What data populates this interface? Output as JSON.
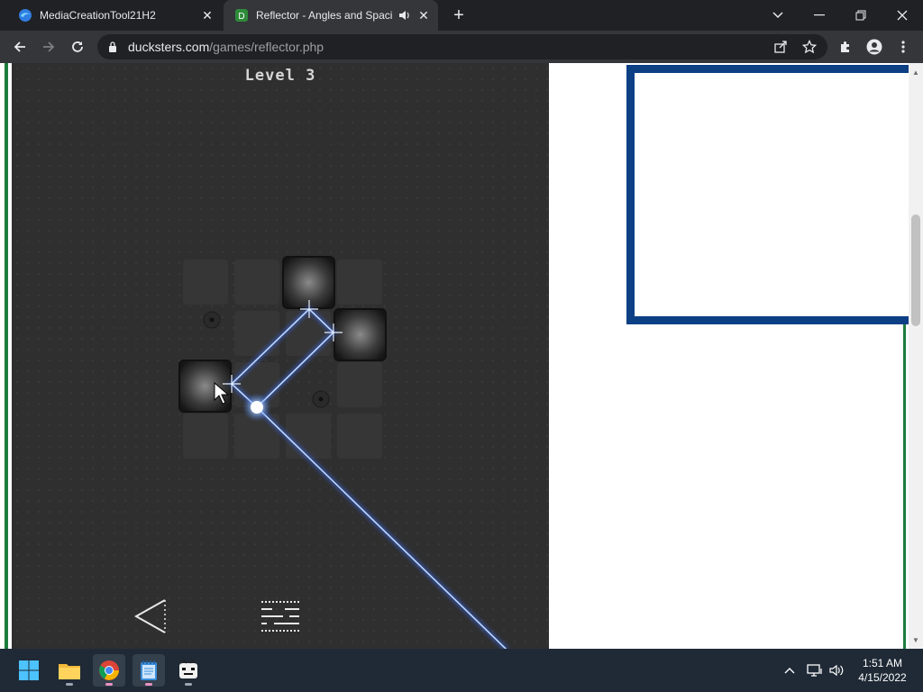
{
  "browser": {
    "tabs": [
      {
        "title": "MediaCreationTool21H2",
        "active": false
      },
      {
        "title": "Reflector - Angles and Spaci",
        "active": true
      }
    ],
    "new_tab_icon": "plus-icon",
    "address": {
      "host": "ducksters.com",
      "path": "/games/reflector.php"
    }
  },
  "game": {
    "level_label": "Level  3",
    "back_icon": "back-triangle-icon",
    "menu_icon": "menu-lines-icon",
    "beam_color": "#5aa0ff",
    "grid": {
      "rows": 4,
      "cols": 4,
      "mirror_cells": [
        [
          0,
          2
        ],
        [
          1,
          3
        ],
        [
          2,
          0
        ]
      ],
      "hole_cells": [
        [
          1,
          0
        ],
        [
          2,
          2
        ]
      ],
      "empty_cells": [
        [
          0,
          0
        ],
        [
          0,
          1
        ],
        [
          0,
          3
        ],
        [
          1,
          1
        ],
        [
          1,
          2
        ],
        [
          2,
          1
        ],
        [
          2,
          3
        ],
        [
          3,
          0
        ],
        [
          3,
          1
        ],
        [
          3,
          2
        ],
        [
          3,
          3
        ]
      ]
    },
    "light_source": "glowing-orb"
  },
  "ad_frame_color": "#0d3f85",
  "taskbar": {
    "apps": [
      "start-icon",
      "file-explorer-icon",
      "chrome-icon",
      "notepad-icon",
      "game-app-icon"
    ],
    "clock": {
      "time": "1:51 AM",
      "date": "4/15/2022"
    }
  }
}
